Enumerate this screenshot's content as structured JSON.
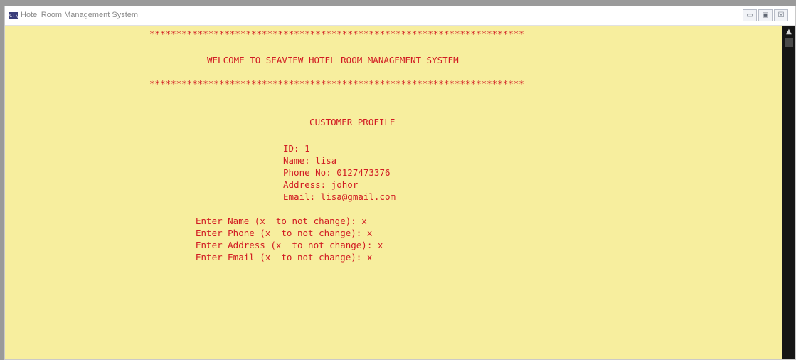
{
  "window": {
    "title": "Hotel Room Management System",
    "icon_text": "C:\\",
    "controls": {
      "minimize": "▭",
      "maximize": "▣",
      "close": "☒"
    }
  },
  "console": {
    "stars_top": "**********************************************************************",
    "welcome": "WELCOME TO SEAVIEW HOTEL ROOM MANAGEMENT SYSTEM",
    "stars_bottom": "**********************************************************************",
    "profile_header": "____________________ CUSTOMER PROFILE ___________________",
    "profile": {
      "id": "ID: 1",
      "name": "Name: lisa",
      "phone": "Phone No: 0127473376",
      "address": "Address: johor",
      "email": "Email: lisa@gmail.com"
    },
    "prompts": {
      "name": "Enter Name (x  to not change): x",
      "phone": "Enter Phone (x  to not change): x",
      "address": "Enter Address (x  to not change): x",
      "email": "Enter Email (x  to not change): x"
    }
  },
  "colors": {
    "background": "#f7ee9e",
    "text": "#d11b22",
    "scrollbar": "#151515"
  },
  "icons": {
    "app": "console-app-icon",
    "scroll_up": "scroll-up-arrow-icon"
  }
}
